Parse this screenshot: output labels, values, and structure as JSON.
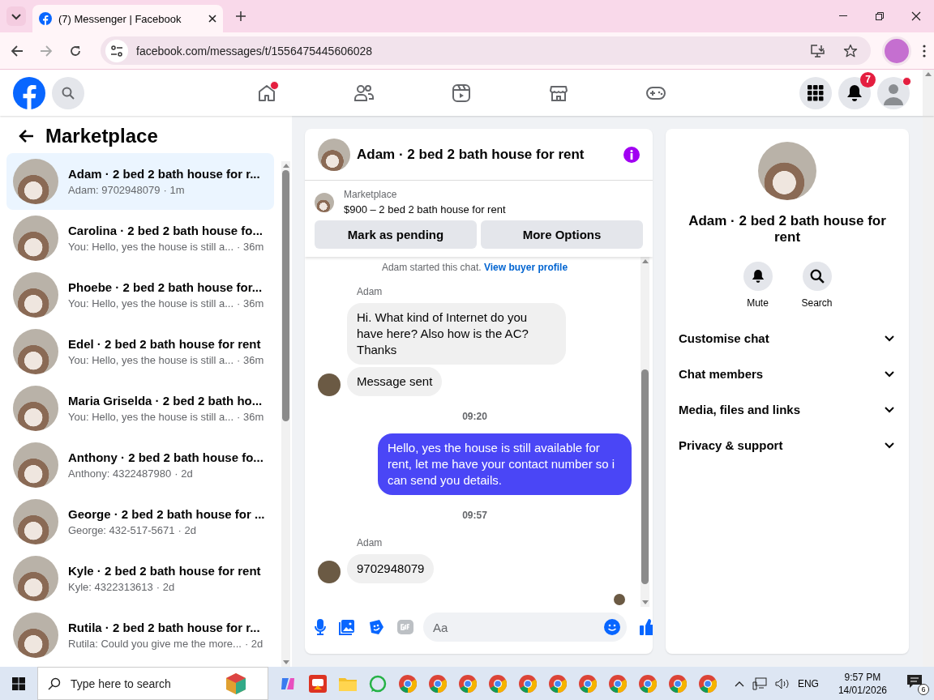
{
  "browser": {
    "tab_title": "(7) Messenger | Facebook",
    "url": "facebook.com/messages/t/1556475445606028"
  },
  "topbar": {
    "nav": [
      {
        "kind": "home",
        "dot": true
      },
      {
        "kind": "friends",
        "dot": false
      },
      {
        "kind": "video",
        "dot": false
      },
      {
        "kind": "marketplace",
        "dot": false
      },
      {
        "kind": "gaming",
        "dot": false
      }
    ],
    "notifications_badge": "7",
    "profile_dot": true
  },
  "sidebar": {
    "title": "Marketplace",
    "conversations": [
      {
        "name": "Adam · 2 bed 2 bath house for r...",
        "preview": "Adam: 9702948079",
        "time": "· 1m",
        "selected": true
      },
      {
        "name": "Carolina · 2 bed 2 bath house fo...",
        "preview": "You: Hello, yes the house is still a...",
        "time": "· 36m",
        "selected": false
      },
      {
        "name": "Phoebe · 2 bed 2 bath house for...",
        "preview": "You: Hello, yes the house is still a...",
        "time": "· 36m",
        "selected": false
      },
      {
        "name": "Edel · 2 bed 2 bath house for rent",
        "preview": "You: Hello, yes the house is still a...",
        "time": "· 36m",
        "selected": false
      },
      {
        "name": "Maria Griselda · 2 bed 2 bath ho...",
        "preview": "You: Hello, yes the house is still a...",
        "time": "· 36m",
        "selected": false
      },
      {
        "name": "Anthony · 2 bed 2 bath house fo...",
        "preview": "Anthony: 4322487980",
        "time": "· 2d",
        "selected": false
      },
      {
        "name": "George · 2 bed 2 bath house for ...",
        "preview": "George: 432-517-5671",
        "time": "· 2d",
        "selected": false
      },
      {
        "name": "Kyle · 2 bed 2 bath house for rent",
        "preview": "Kyle: 4322313613",
        "time": "· 2d",
        "selected": false
      },
      {
        "name": "Rutila · 2 bed 2 bath house for r...",
        "preview": "Rutila: Could you give me the more...",
        "time": "· 2d",
        "selected": false
      }
    ]
  },
  "chat": {
    "title": "Adam · 2 bed 2 bath house for rent",
    "listing": {
      "label": "Marketplace",
      "text": "$900 – 2 bed 2 bath house for rent"
    },
    "buttons": [
      "Mark as pending",
      "More Options"
    ],
    "intro": {
      "text": "Adam started this chat.",
      "link": "View buyer profile"
    },
    "messages": [
      {
        "kind": "sender",
        "text": "Adam"
      },
      {
        "kind": "incoming",
        "text": "Hi. What kind of Internet do you have here? Also how is the AC? Thanks",
        "avatar": false
      },
      {
        "kind": "incoming",
        "text": "Message sent",
        "avatar": true
      },
      {
        "kind": "time",
        "text": "09:20"
      },
      {
        "kind": "outgoing",
        "text": "Hello, yes the house is still available for rent, let me have your contact number so i can send you details."
      },
      {
        "kind": "time",
        "text": "09:57"
      },
      {
        "kind": "sender",
        "text": "Adam"
      },
      {
        "kind": "incoming",
        "text": "9702948079",
        "avatar": true
      }
    ],
    "composer": {
      "placeholder": "Aa"
    }
  },
  "details": {
    "name": "Adam · 2 bed 2 bath house for rent",
    "actions": [
      {
        "kind": "mute",
        "label": "Mute"
      },
      {
        "kind": "search",
        "label": "Search"
      }
    ],
    "sections": [
      "Customise chat",
      "Chat members",
      "Media, files and links",
      "Privacy & support"
    ]
  },
  "taskbar": {
    "search_placeholder": "Type here to search",
    "language": "ENG",
    "time": "9:57 PM",
    "date": "14/01/2026",
    "notification_count": "6"
  }
}
